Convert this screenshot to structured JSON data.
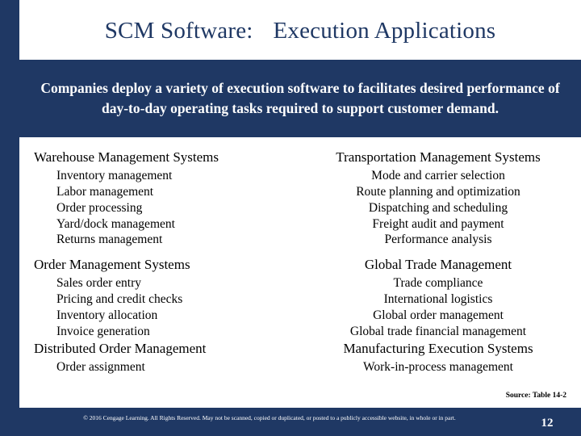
{
  "slide": {
    "title_main": "SCM Software:",
    "title_sub": "Execution Applications",
    "subtitle": "Companies deploy a variety of execution software to facilitates desired performance of day-to-day operating tasks required to support customer demand.",
    "source_note": "Source: Table 14-2",
    "copyright": "© 2016 Cengage Learning. All Rights Reserved. May not be scanned, copied or duplicated, or posted to a publicly accessible website, in whole or in part.",
    "page_number": "12",
    "colors": {
      "navy": "#1f3864",
      "white": "#ffffff",
      "text": "#000000"
    }
  },
  "columns": {
    "left": [
      {
        "heading": "Warehouse Management Systems",
        "items": [
          "Inventory management",
          "Labor management",
          "Order processing",
          "Yard/dock management",
          "Returns management"
        ]
      },
      {
        "heading": "Order Management Systems",
        "items": [
          "Sales order entry",
          "Pricing and credit checks",
          "Inventory allocation",
          "Invoice generation"
        ]
      },
      {
        "heading": "Distributed Order Management",
        "items": [
          "Order assignment"
        ]
      }
    ],
    "right": [
      {
        "heading": "Transportation Management Systems",
        "items": [
          "Mode and carrier selection",
          "Route planning and optimization",
          "Dispatching and scheduling",
          "Freight audit and payment",
          "Performance analysis"
        ]
      },
      {
        "heading": "Global Trade Management",
        "items": [
          "Trade compliance",
          "International logistics",
          "Global order management",
          "Global trade financial management"
        ]
      },
      {
        "heading": "Manufacturing Execution Systems",
        "items": [
          "Work-in-process management"
        ]
      }
    ]
  }
}
